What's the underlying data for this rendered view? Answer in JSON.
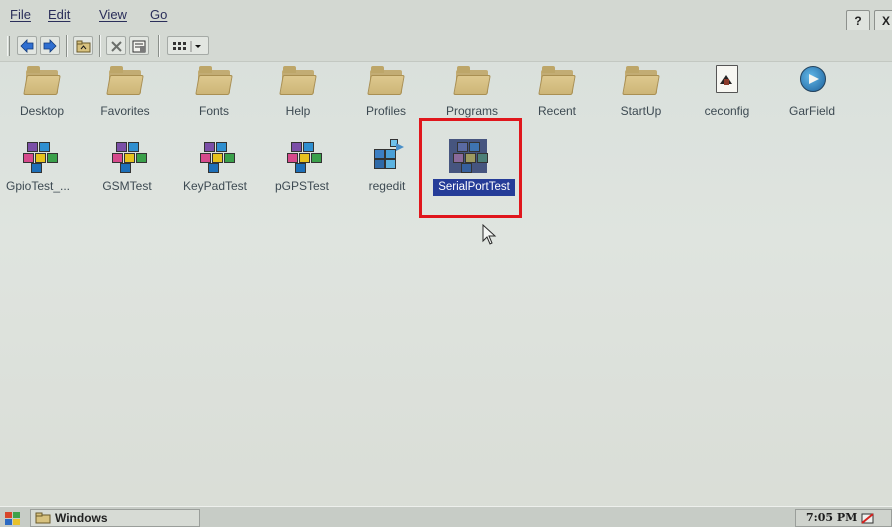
{
  "menubar": {
    "file": "File",
    "edit": "Edit",
    "view": "View",
    "go": "Go",
    "help": "?",
    "close": "X"
  },
  "toolbar": {
    "buttons": [
      "back-icon",
      "forward-icon",
      "up-folder-icon",
      "delete-icon",
      "properties-icon",
      "views-icon"
    ]
  },
  "folders": [
    {
      "label": "Desktop",
      "icon": "folder-icon"
    },
    {
      "label": "Favorites",
      "icon": "folder-icon"
    },
    {
      "label": "Fonts",
      "icon": "folder-icon"
    },
    {
      "label": "Help",
      "icon": "folder-icon"
    },
    {
      "label": "Profiles",
      "icon": "folder-icon"
    },
    {
      "label": "Programs",
      "icon": "folder-icon"
    },
    {
      "label": "Recent",
      "icon": "folder-icon"
    },
    {
      "label": "StartUp",
      "icon": "folder-icon"
    },
    {
      "label": "ceconfig",
      "icon": "document-icon"
    },
    {
      "label": "GarField",
      "icon": "media-icon"
    }
  ],
  "apps": [
    {
      "label": "GpioTest_...",
      "icon": "app-cubes-icon"
    },
    {
      "label": "GSMTest",
      "icon": "app-cubes-icon"
    },
    {
      "label": "KeyPadTest",
      "icon": "app-cubes-icon"
    },
    {
      "label": "pGPSTest",
      "icon": "app-cubes-icon"
    },
    {
      "label": "regedit",
      "icon": "registry-icon"
    },
    {
      "label": "SerialPortTest",
      "icon": "app-cubes-icon",
      "selected": true
    }
  ],
  "taskbar": {
    "task": "Windows",
    "clock": "7:05 PM"
  },
  "colors": {
    "desktop": "#dde2dd",
    "selection": "#253c98",
    "highlight_box": "#e0161c"
  }
}
